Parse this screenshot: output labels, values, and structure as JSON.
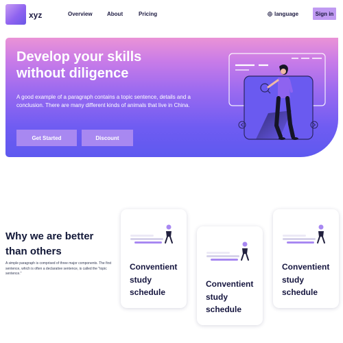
{
  "brand": {
    "name": "xyz"
  },
  "nav": {
    "links": [
      "Overview",
      "About",
      "Pricing"
    ],
    "language": "language",
    "signin": "Sign in"
  },
  "hero": {
    "title_line1": "Develop your skills",
    "title_line2": "without diligence",
    "text": "A good example of a paragraph contains a topic sentence, details and a conclusion. There are many different kinds of animals that live in China.",
    "buttons": {
      "start": "Get Started",
      "discount": "Discount"
    }
  },
  "why": {
    "title_line1": "Why we are better",
    "title_line2": "than others",
    "text": "A simple paragraph is comprised of three major components. The first sentence, which is often a declarative sentence, is called the \"topic sentence.\""
  },
  "cards": [
    {
      "line1": "Conventient",
      "line2": "study",
      "line3": "schedule"
    },
    {
      "line1": "Conventient",
      "line2": "study",
      "line3": "schedule"
    },
    {
      "line1": "Conventient",
      "line2": "study",
      "line3": "schedule"
    }
  ],
  "colors": {
    "accent": "#c09af2",
    "hero_top": "#ea93d6",
    "hero_bottom": "#5e59ef",
    "button": "#a888f1",
    "dark_text": "#121838"
  },
  "icons": [
    "globe-icon",
    "chevron-left-icon",
    "chevron-right-icon"
  ]
}
